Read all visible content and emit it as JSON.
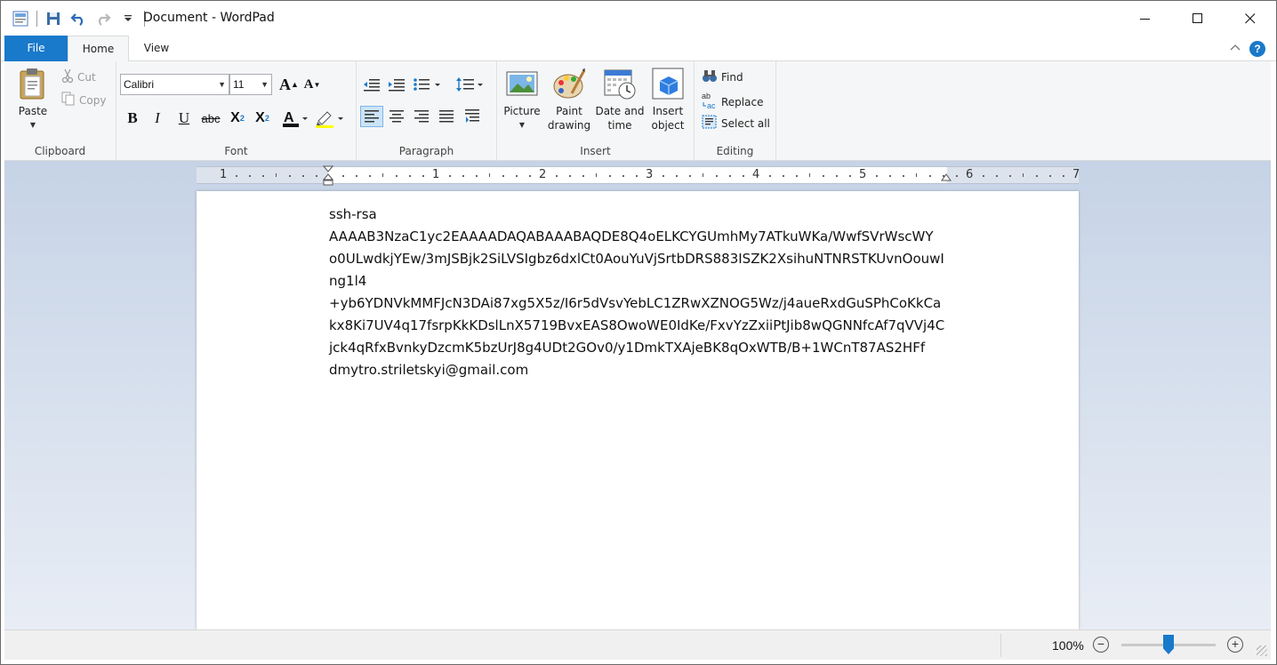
{
  "window": {
    "title": "Document - WordPad",
    "caption": {
      "minimize": "—",
      "maximize": "☐",
      "close": "✕"
    }
  },
  "tabs": [
    {
      "label": "File"
    },
    {
      "label": "Home"
    },
    {
      "label": "View"
    }
  ],
  "ribbon": {
    "clipboard": {
      "label": "Clipboard",
      "paste": "Paste",
      "cut": "Cut",
      "copy": "Copy"
    },
    "font": {
      "label": "Font",
      "family": "Calibri",
      "size": "11",
      "text_color": "#e01f1f",
      "highlight_color": "#ffff00"
    },
    "paragraph": {
      "label": "Paragraph"
    },
    "insert": {
      "label": "Insert",
      "picture": "Picture",
      "paint_drawing_1": "Paint",
      "paint_drawing_2": "drawing",
      "date_time_1": "Date and",
      "date_time_2": "time",
      "insert_object_1": "Insert",
      "insert_object_2": "object"
    },
    "editing": {
      "label": "Editing",
      "find": "Find",
      "replace": "Replace",
      "select_all": "Select all"
    }
  },
  "ruler": {
    "numbers": [
      "1",
      "1",
      "2",
      "3",
      "4",
      "5",
      "6",
      "7"
    ]
  },
  "document": {
    "lines": [
      "ssh-rsa",
      "AAAAB3NzaC1yc2EAAAADAQABAAABAQDE8Q4oELKCYGUmhMy7ATkuWKa/WwfSVrWscWY",
      "o0ULwdkjYEw/3mJSBjk2SiLVSIgbz6dxlCt0AouYuVjSrtbDRS883ISZK2XsihuNTNRSTKUvnOouwI",
      "ng1l4",
      "+yb6YDNVkMMFJcN3DAi87xg5X5z/I6r5dVsvYebLC1ZRwXZNOG5Wz/j4aueRxdGuSPhCoKkCa",
      "kx8Ki7UV4q17fsrpKkKDslLnX5719BvxEAS8OwoWE0IdKe/FxvYzZxiiPtJib8wQGNNfcAf7qVVj4C",
      "jck4qRfxBvnkyDzcmK5bzUrJ8g4UDt2GOv0/y1DmkTXAjeBK8qOxWTB/B+1WCnT87AS2HFf",
      "dmytro.striletskyi@gmail.com"
    ]
  },
  "status": {
    "zoom": "100%"
  },
  "colors": {
    "accent": "#1979ca"
  }
}
